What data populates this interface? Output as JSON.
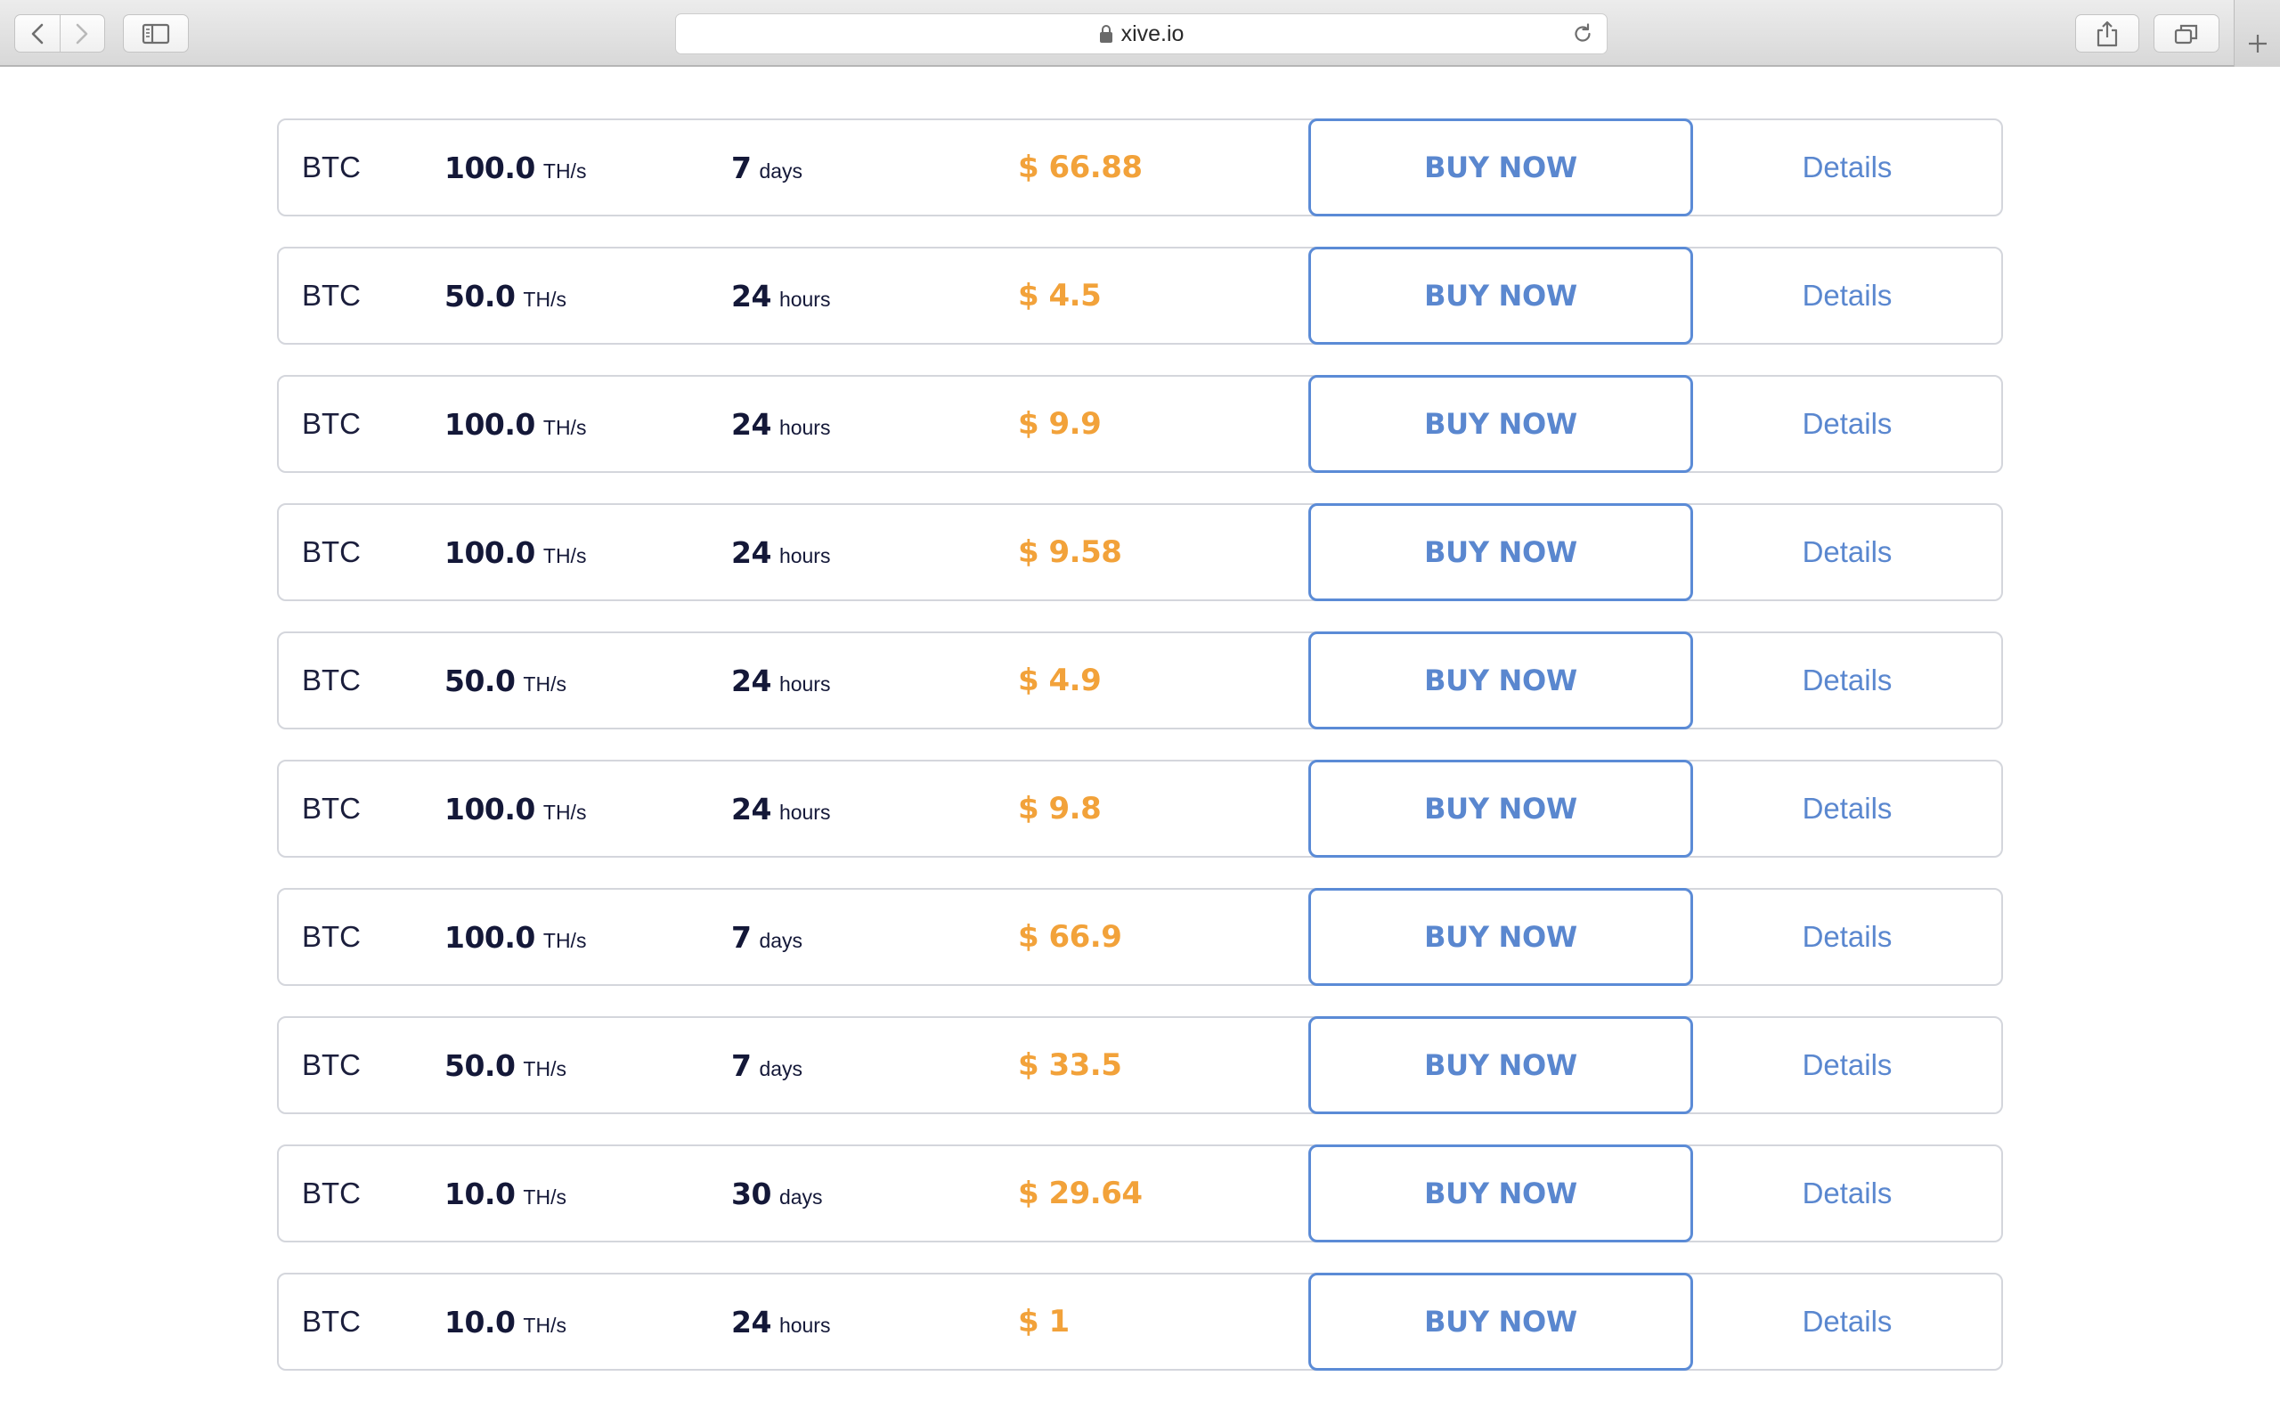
{
  "browser": {
    "url": "xive.io"
  },
  "offers": [
    {
      "coin": "BTC",
      "hashrate": "100.0",
      "hash_unit": "TH/s",
      "duration": "7",
      "duration_unit": "days",
      "price": "$ 66.88",
      "buy_label": "BUY NOW",
      "details_label": "Details"
    },
    {
      "coin": "BTC",
      "hashrate": "50.0",
      "hash_unit": "TH/s",
      "duration": "24",
      "duration_unit": "hours",
      "price": "$ 4.5",
      "buy_label": "BUY NOW",
      "details_label": "Details"
    },
    {
      "coin": "BTC",
      "hashrate": "100.0",
      "hash_unit": "TH/s",
      "duration": "24",
      "duration_unit": "hours",
      "price": "$ 9.9",
      "buy_label": "BUY NOW",
      "details_label": "Details"
    },
    {
      "coin": "BTC",
      "hashrate": "100.0",
      "hash_unit": "TH/s",
      "duration": "24",
      "duration_unit": "hours",
      "price": "$ 9.58",
      "buy_label": "BUY NOW",
      "details_label": "Details"
    },
    {
      "coin": "BTC",
      "hashrate": "50.0",
      "hash_unit": "TH/s",
      "duration": "24",
      "duration_unit": "hours",
      "price": "$ 4.9",
      "buy_label": "BUY NOW",
      "details_label": "Details"
    },
    {
      "coin": "BTC",
      "hashrate": "100.0",
      "hash_unit": "TH/s",
      "duration": "24",
      "duration_unit": "hours",
      "price": "$ 9.8",
      "buy_label": "BUY NOW",
      "details_label": "Details"
    },
    {
      "coin": "BTC",
      "hashrate": "100.0",
      "hash_unit": "TH/s",
      "duration": "7",
      "duration_unit": "days",
      "price": "$ 66.9",
      "buy_label": "BUY NOW",
      "details_label": "Details"
    },
    {
      "coin": "BTC",
      "hashrate": "50.0",
      "hash_unit": "TH/s",
      "duration": "7",
      "duration_unit": "days",
      "price": "$ 33.5",
      "buy_label": "BUY NOW",
      "details_label": "Details"
    },
    {
      "coin": "BTC",
      "hashrate": "10.0",
      "hash_unit": "TH/s",
      "duration": "30",
      "duration_unit": "days",
      "price": "$ 29.64",
      "buy_label": "BUY NOW",
      "details_label": "Details"
    },
    {
      "coin": "BTC",
      "hashrate": "10.0",
      "hash_unit": "TH/s",
      "duration": "24",
      "duration_unit": "hours",
      "price": "$ 1",
      "buy_label": "BUY NOW",
      "details_label": "Details"
    }
  ],
  "colors": {
    "price": "#f2a23a",
    "accent": "#5a87cf",
    "text_dark": "#141838"
  }
}
